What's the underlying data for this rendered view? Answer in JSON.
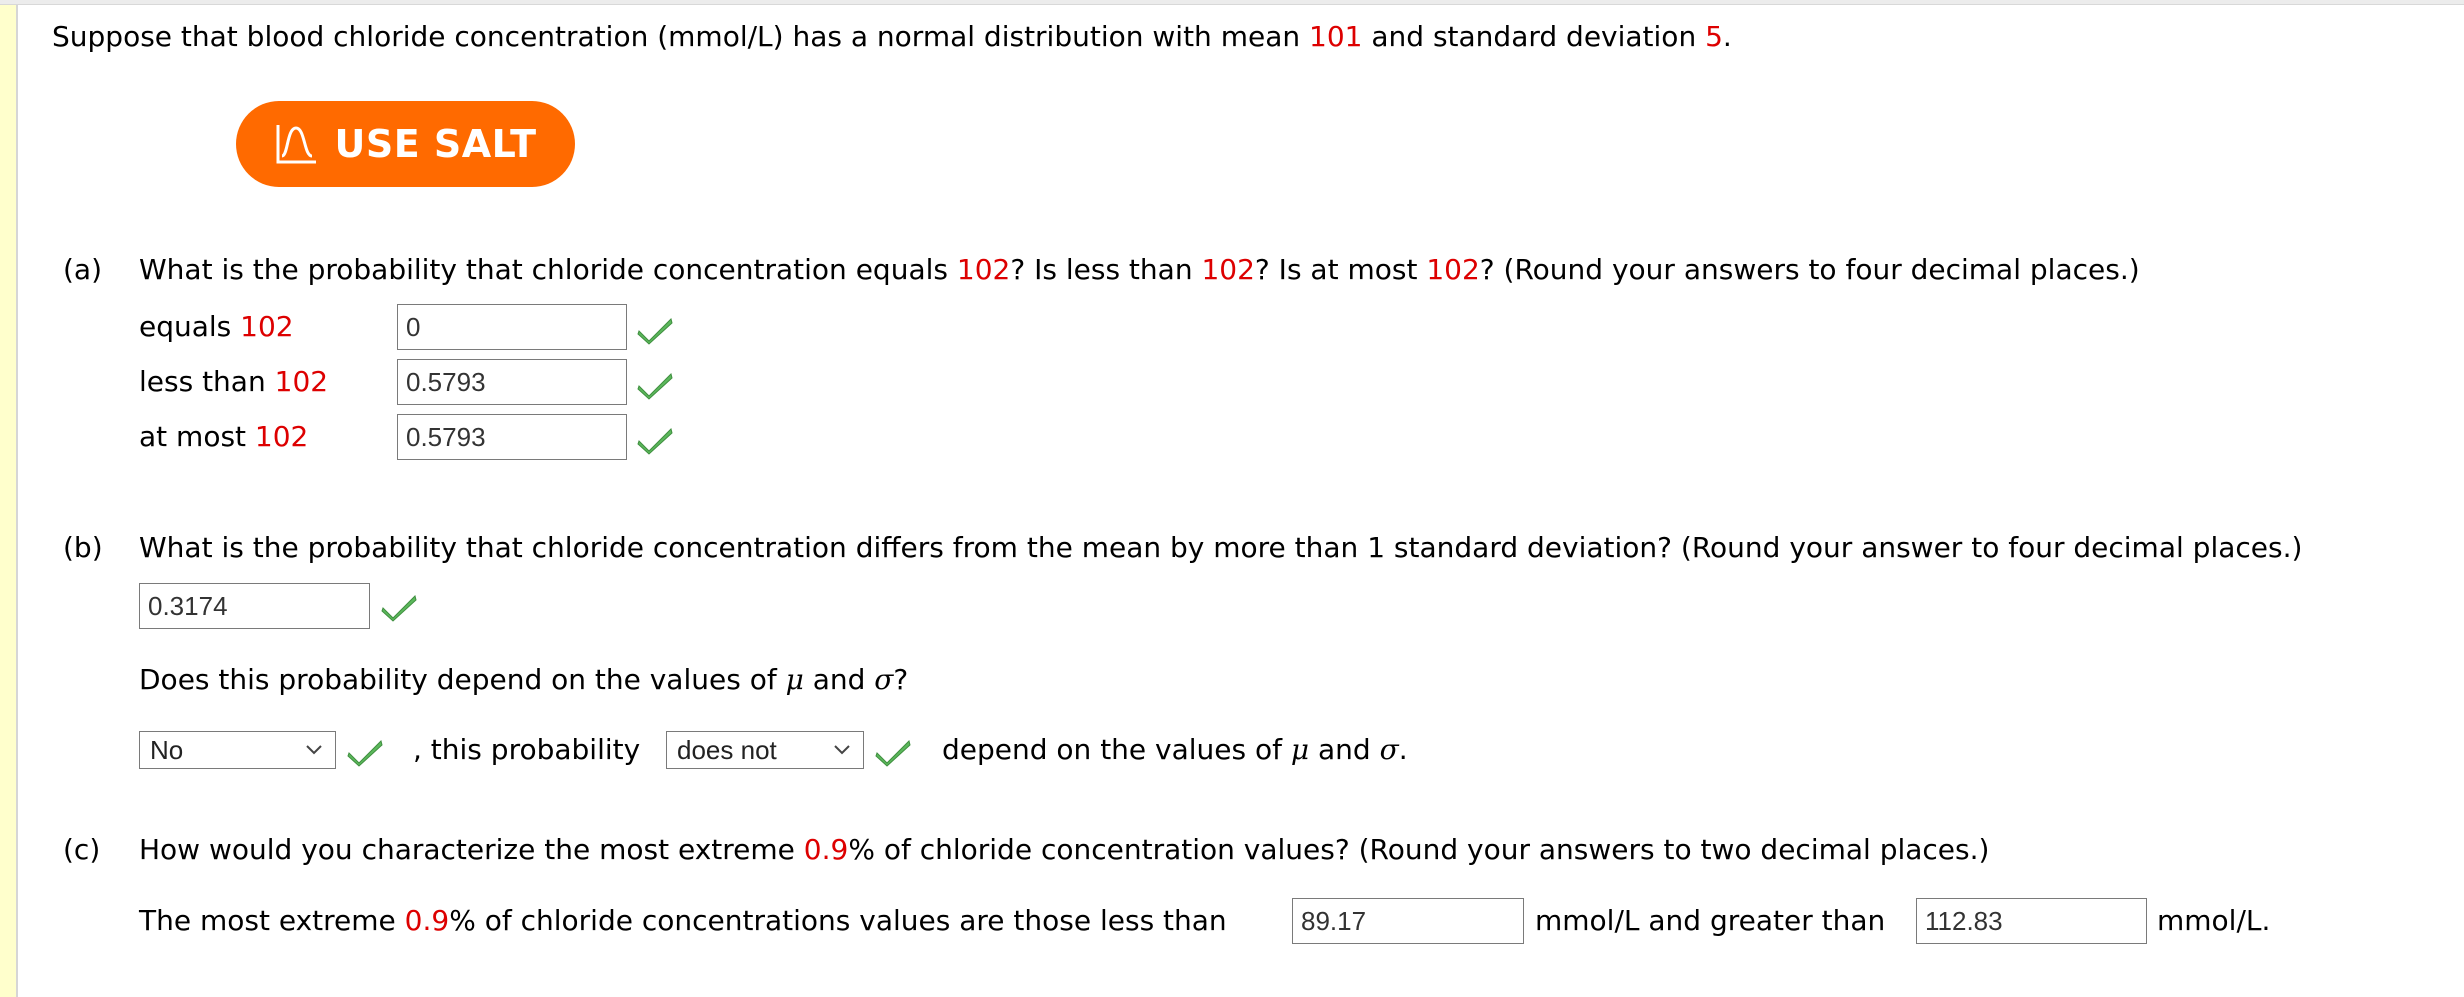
{
  "intro": {
    "text_before_mean": "Suppose that blood chloride concentration (mmol/L) has a normal distribution with mean ",
    "mean": "101",
    "text_before_sd": " and standard deviation ",
    "sd": "5",
    "text_end": "."
  },
  "salt_button": {
    "label": "USE SALT",
    "icon": "bell-curve-icon",
    "color": "#ff6a00"
  },
  "colors": {
    "highlight": "#dd0000",
    "check": "#5cb85c",
    "sidebar_stripe": "#ffffcc"
  },
  "part_a": {
    "letter": "(a)",
    "q1": "What is the probability that chloride concentration equals ",
    "v1": "102",
    "q2": "? Is less than ",
    "v2": "102",
    "q3": "? Is at most ",
    "v3": "102",
    "q4": "? (Round your answers to four decimal places.)",
    "rows": [
      {
        "label": "equals ",
        "value_label": "102",
        "answer": "0",
        "status": "correct"
      },
      {
        "label": "less than ",
        "value_label": "102",
        "answer": "0.5793",
        "status": "correct"
      },
      {
        "label": "at most ",
        "value_label": "102",
        "answer": "0.5793",
        "status": "correct"
      }
    ]
  },
  "part_b": {
    "letter": "(b)",
    "question": "What is the probability that chloride concentration differs from the mean by more than 1 standard deviation? (Round your answer to four decimal places.)",
    "answer": "0.3174",
    "answer_status": "correct",
    "dependence_q_prefix": "Does this probability depend on the values of ",
    "mu": "μ",
    "and": " and ",
    "sigma": "σ",
    "dependence_q_suffix": "?",
    "select1": {
      "selected": "No",
      "status": "correct"
    },
    "mid_text": ", this probability",
    "select2": {
      "selected": "does not",
      "status": "correct"
    },
    "end_prefix": "depend on the values of ",
    "end_suffix": "."
  },
  "part_c": {
    "letter": "(c)",
    "q_prefix": "How would you characterize the most extreme ",
    "percent": "0.9",
    "q_suffix": "% of chloride concentration values? (Round your answers to two decimal places.)",
    "ans_prefix": "The most extreme ",
    "ans_percent": "0.9",
    "ans_mid": "% of chloride concentrations values are those less than",
    "lower": "89.17",
    "unit_mid": "mmol/L and greater than",
    "upper": "112.83",
    "unit_end": "mmol/L."
  }
}
